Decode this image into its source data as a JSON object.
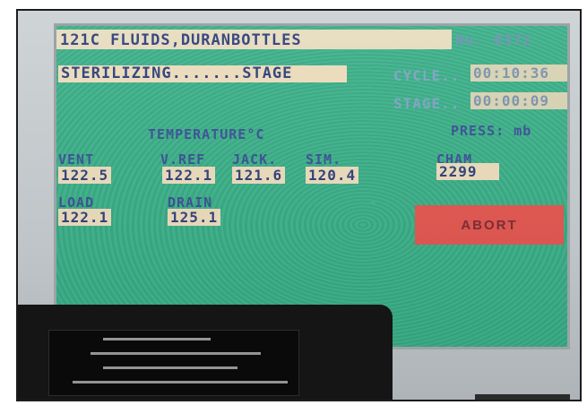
{
  "header": {
    "title": "121C FLUIDS,DURANBOTTLES",
    "no_label": "No.",
    "no_value": "0372"
  },
  "status": {
    "stage_name": "STERILIZING.......STAGE",
    "cycle_label": "CYCLE..",
    "cycle_time": "00:10:36",
    "stage_label": "STAGE..",
    "stage_time": "00:00:09"
  },
  "temperature": {
    "heading": "TEMPERATURE°C",
    "labels": {
      "vent": "VENT",
      "vref": "V.REF",
      "jack": "JACK.",
      "sim": "SIM.",
      "load": "LOAD",
      "drain": "DRAIN"
    },
    "values": {
      "vent": "122.5",
      "vref": "122.1",
      "jack": "121.6",
      "sim": "120.4",
      "load": "122.1",
      "drain": "125.1"
    }
  },
  "pressure": {
    "heading": "PRESS: mb",
    "cham_label": "CHAM",
    "cham_value": "2299"
  },
  "actions": {
    "abort_label": "ABORT"
  },
  "colors": {
    "screen": "#3bae87",
    "value_box": "#ecdcbc",
    "label_text": "#3a4f95",
    "abort_button": "#e2564f"
  }
}
